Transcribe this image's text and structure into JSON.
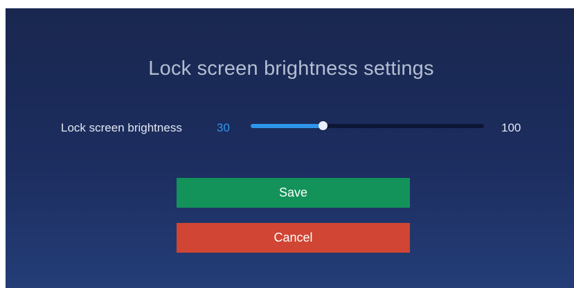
{
  "dialog": {
    "title": "Lock screen brightness settings",
    "brightness_label": "Lock screen brightness",
    "brightness_value": "30",
    "brightness_max": "100",
    "slider_fraction": 0.31,
    "save_label": "Save",
    "cancel_label": "Cancel"
  },
  "colors": {
    "accent": "#2f95ea",
    "save": "#13925a",
    "cancel": "#d04533"
  }
}
